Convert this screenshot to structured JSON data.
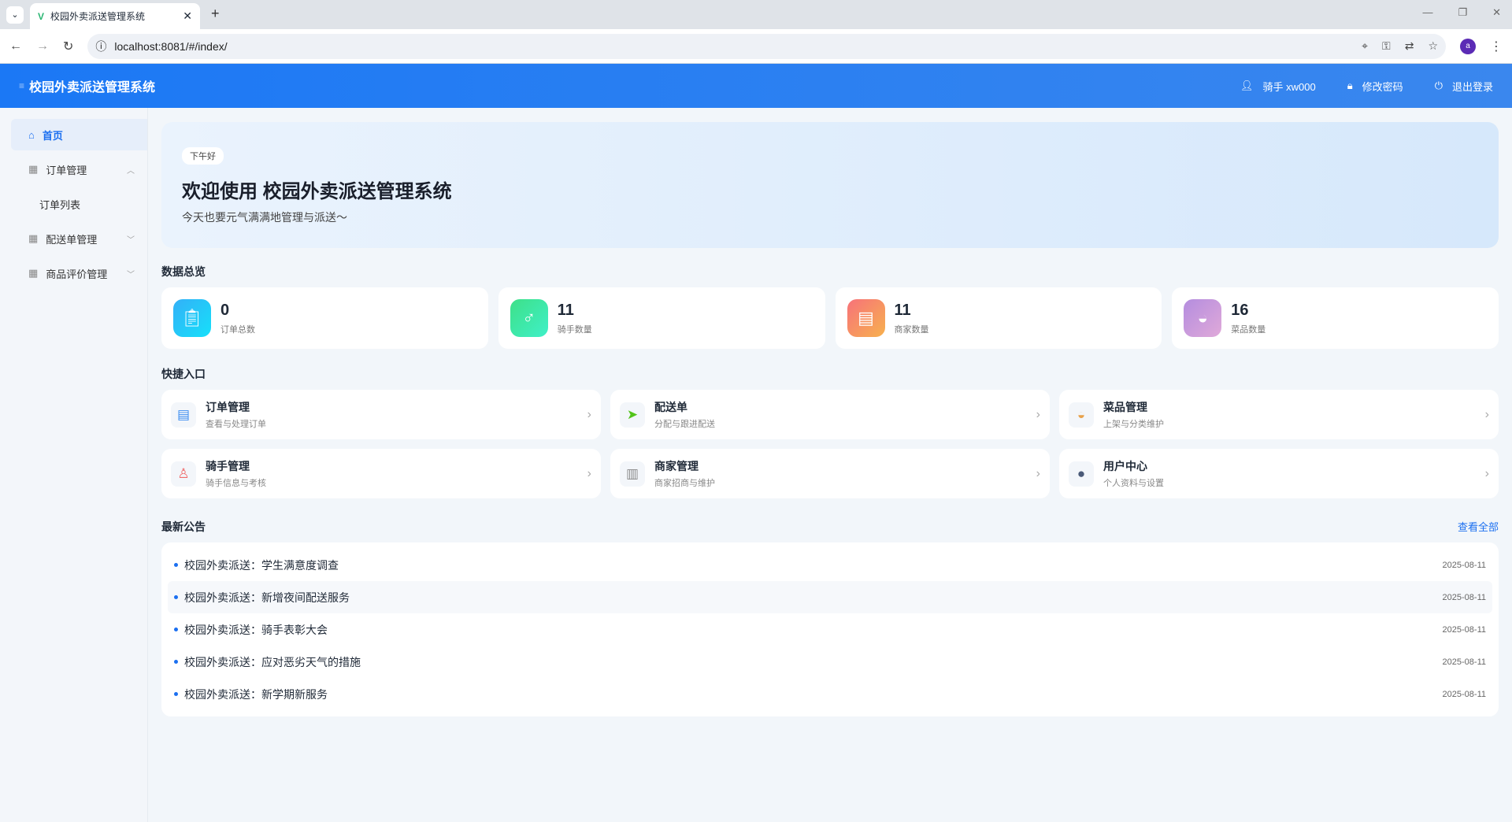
{
  "browser": {
    "tab_title": "校园外卖派送管理系统",
    "url": "localhost:8081/#/index/",
    "profile_initial": "a"
  },
  "header": {
    "title": "校园外卖派送管理系统",
    "user": "骑手 xw000",
    "change_password": "修改密码",
    "logout": "退出登录"
  },
  "sidebar": {
    "items": [
      {
        "label": "首页"
      },
      {
        "label": "订单管理"
      },
      {
        "label": "订单列表"
      },
      {
        "label": "配送单管理"
      },
      {
        "label": "商品评价管理"
      }
    ]
  },
  "hero": {
    "badge": "下午好",
    "title": "欢迎使用 校园外卖派送管理系统",
    "subtitle": "今天也要元气满满地管理与派送～"
  },
  "overview": {
    "title": "数据总览",
    "stats": [
      {
        "value": "0",
        "label": "订单总数",
        "color": "#2bb5f7"
      },
      {
        "value": "11",
        "label": "骑手数量",
        "color": "#3be39a"
      },
      {
        "value": "11",
        "label": "商家数量",
        "color": "#f7856b"
      },
      {
        "value": "16",
        "label": "菜品数量",
        "color": "#b48ddf"
      }
    ]
  },
  "quick": {
    "title": "快捷入口",
    "items": [
      {
        "title": "订单管理",
        "sub": "查看与处理订单"
      },
      {
        "title": "配送单",
        "sub": "分配与跟进配送"
      },
      {
        "title": "菜品管理",
        "sub": "上架与分类维护"
      },
      {
        "title": "骑手管理",
        "sub": "骑手信息与考核"
      },
      {
        "title": "商家管理",
        "sub": "商家招商与维护"
      },
      {
        "title": "用户中心",
        "sub": "个人资料与设置"
      }
    ]
  },
  "notices": {
    "title": "最新公告",
    "view_all": "查看全部",
    "items": [
      {
        "title": "校园外卖派送：学生满意度调查",
        "date": "2025-08-11"
      },
      {
        "title": "校园外卖派送：新增夜间配送服务",
        "date": "2025-08-11"
      },
      {
        "title": "校园外卖派送：骑手表彰大会",
        "date": "2025-08-11"
      },
      {
        "title": "校园外卖派送：应对恶劣天气的措施",
        "date": "2025-08-11"
      },
      {
        "title": "校园外卖派送：新学期新服务",
        "date": "2025-08-11"
      }
    ]
  }
}
